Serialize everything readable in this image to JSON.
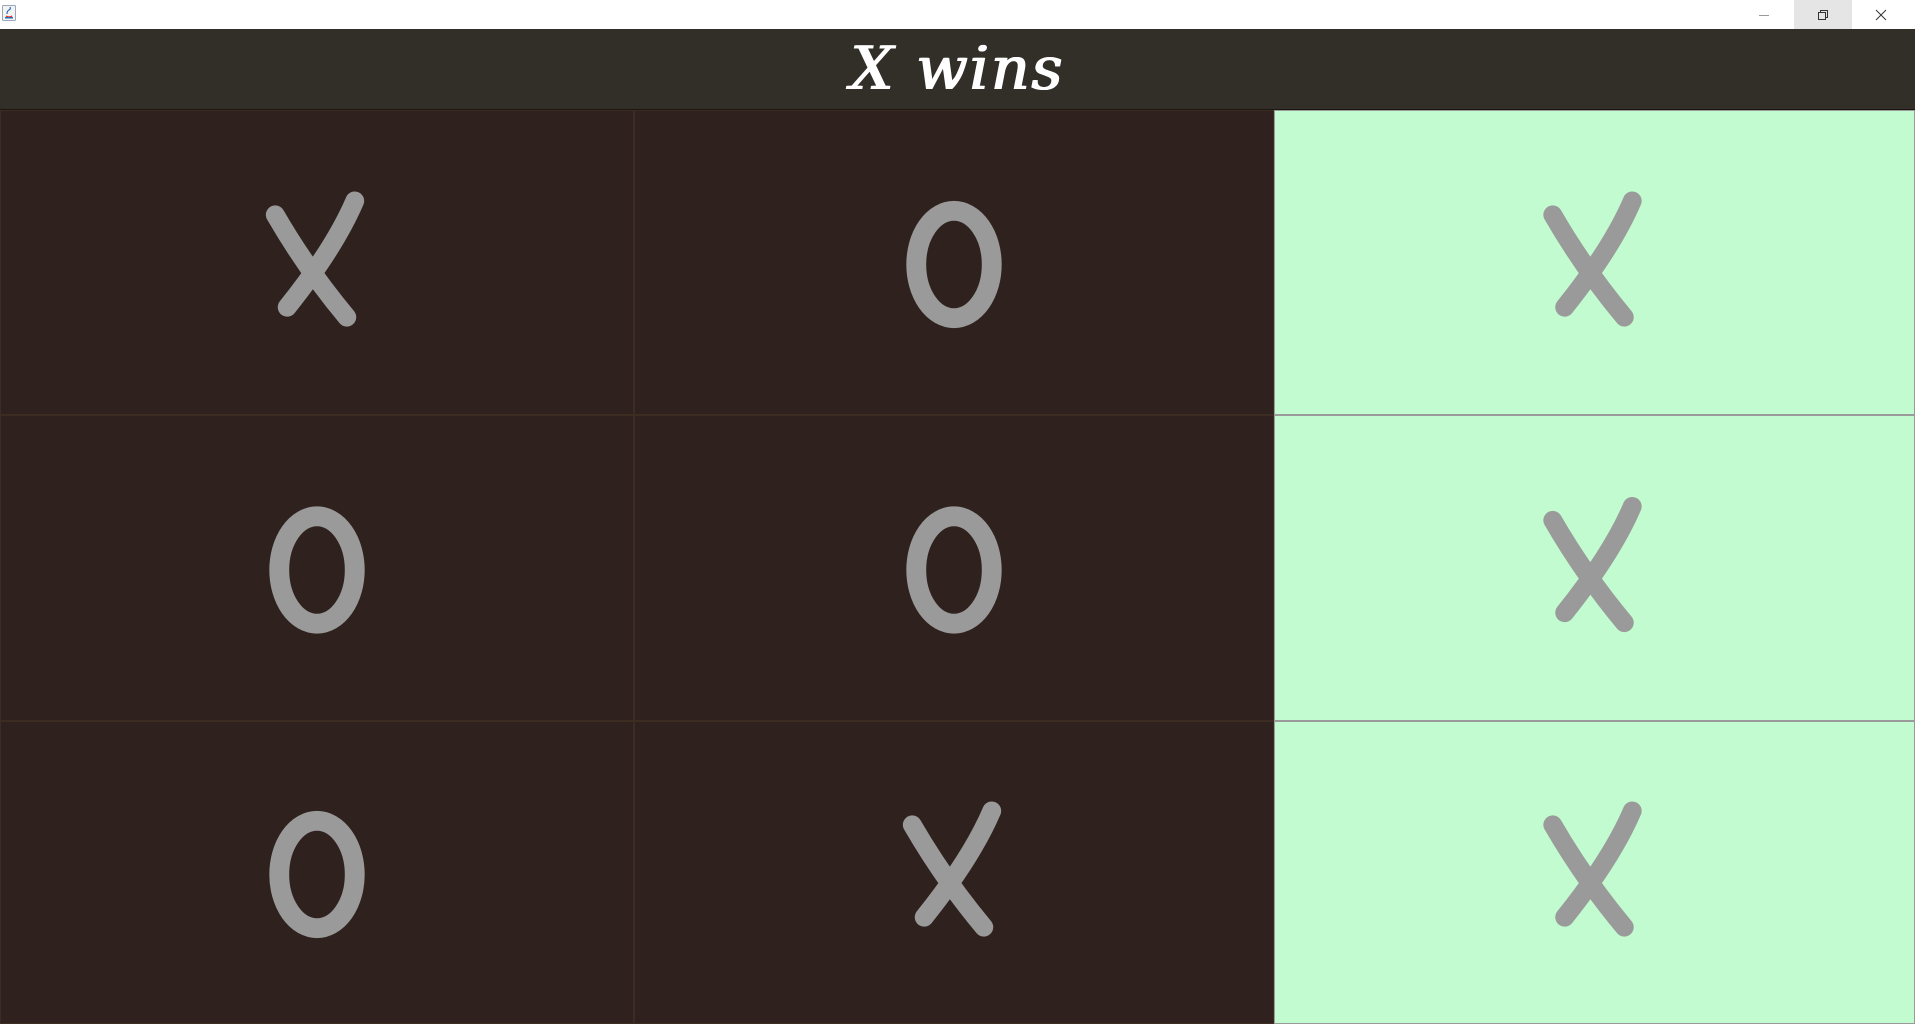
{
  "window": {
    "icon": "java-icon",
    "controls": {
      "minimize": "minimize-icon",
      "restore": "restore-icon",
      "close": "close-icon"
    }
  },
  "header": {
    "status": "X wins"
  },
  "board": {
    "cells": [
      {
        "mark": "X",
        "highlight": false
      },
      {
        "mark": "O",
        "highlight": false
      },
      {
        "mark": "X",
        "highlight": true
      },
      {
        "mark": "O",
        "highlight": false
      },
      {
        "mark": "O",
        "highlight": false
      },
      {
        "mark": "X",
        "highlight": true
      },
      {
        "mark": "O",
        "highlight": false
      },
      {
        "mark": "X",
        "highlight": false
      },
      {
        "mark": "X",
        "highlight": true
      }
    ]
  },
  "colors": {
    "header_bg": "#322e28",
    "cell_bg": "#2f221e",
    "win_cell_bg": "#c2fbd0",
    "mark_color": "#9a9a9a",
    "status_text": "#ffffff"
  }
}
